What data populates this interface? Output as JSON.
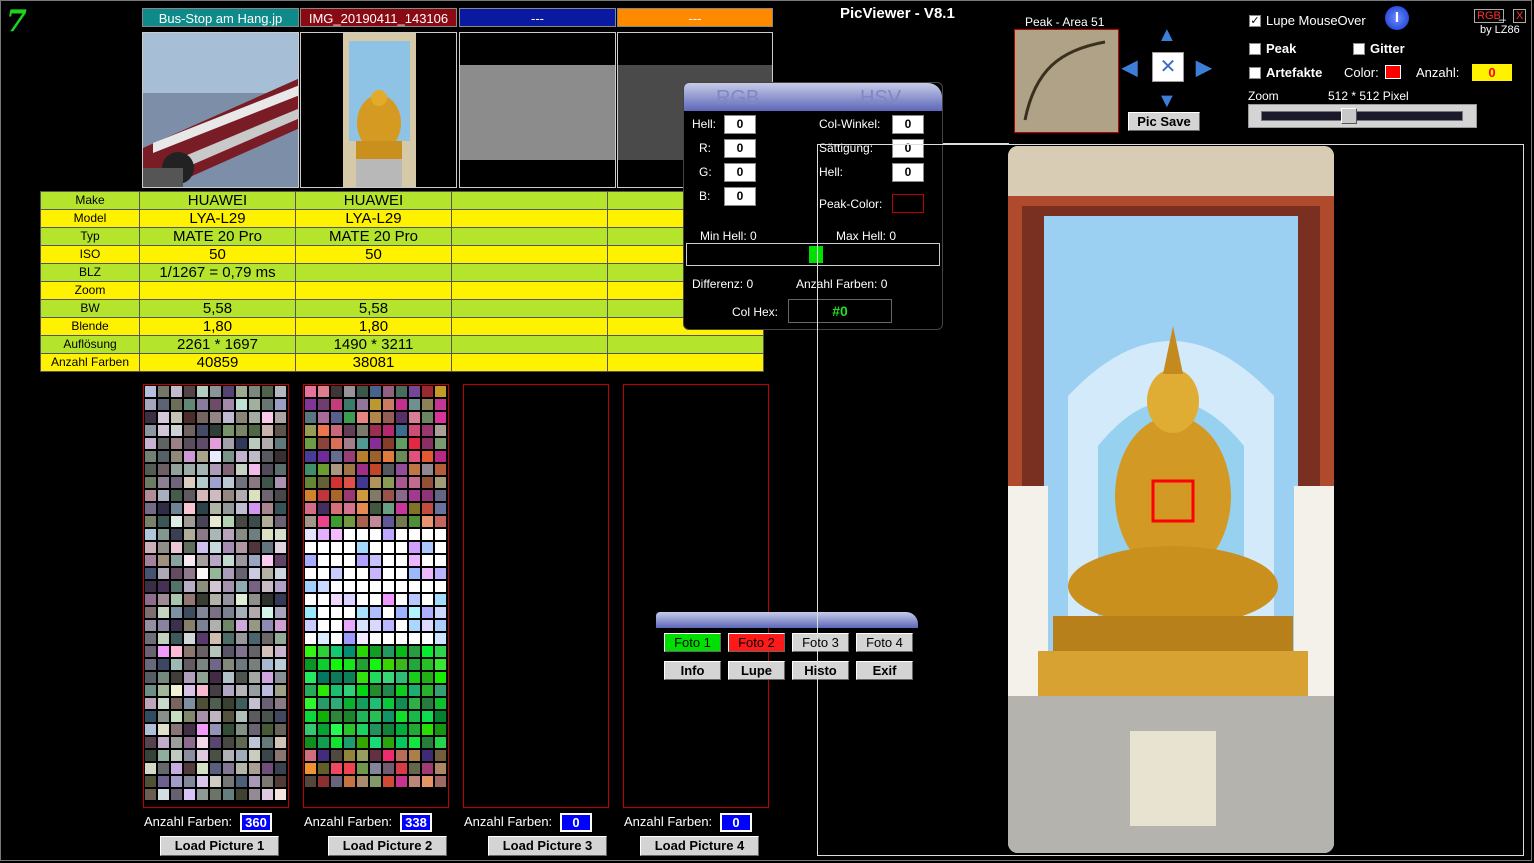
{
  "app": {
    "title": "PicViewer - V8.1",
    "logo": "7"
  },
  "tabs": [
    {
      "label": "Bus-Stop am Hang.jp",
      "color": "#0f8a8a"
    },
    {
      "label": "IMG_20190411_143106",
      "color": "#8a0a14"
    },
    {
      "label": "---",
      "color": "#0a1aa0"
    },
    {
      "label": "---",
      "color": "#ff8a00"
    }
  ],
  "exif": {
    "rows": [
      {
        "label": "Make",
        "v1": "HUAWEI",
        "v2": "HUAWEI",
        "v3": "",
        "v4": ""
      },
      {
        "label": "Model",
        "v1": "LYA-L29",
        "v2": "LYA-L29",
        "v3": "",
        "v4": ""
      },
      {
        "label": "Typ",
        "v1": "MATE 20 Pro",
        "v2": "MATE 20 Pro",
        "v3": "",
        "v4": ""
      },
      {
        "label": "ISO",
        "v1": "50",
        "v2": "50",
        "v3": "",
        "v4": ""
      },
      {
        "label": "BLZ",
        "v1": "1/1267 = 0,79 ms",
        "v2": "",
        "v3": "",
        "v4": ""
      },
      {
        "label": "Zoom",
        "v1": "",
        "v2": "",
        "v3": "",
        "v4": ""
      },
      {
        "label": "BW",
        "v1": "5,58",
        "v2": "5,58",
        "v3": "",
        "v4": ""
      },
      {
        "label": "Blende",
        "v1": "1,80",
        "v2": "1,80",
        "v3": "",
        "v4": ""
      },
      {
        "label": "Auflösung",
        "v1": "2261 * 1697",
        "v2": "1490 * 3211",
        "v3": "",
        "v4": ""
      },
      {
        "label": "Anzahl Farben",
        "v1": "40859",
        "v2": "38081",
        "v3": "",
        "v4": ""
      }
    ]
  },
  "palettes": [
    {
      "count_label": "Anzahl Farben:",
      "count": "360",
      "load": "Load Picture 1"
    },
    {
      "count_label": "Anzahl Farben:",
      "count": "338",
      "load": "Load Picture 2"
    },
    {
      "count_label": "Anzahl Farben:",
      "count": "0",
      "load": "Load Picture 3"
    },
    {
      "count_label": "Anzahl Farben:",
      "count": "0",
      "load": "Load Picture 4"
    }
  ],
  "color_panel": {
    "tab_rgb": "RGB",
    "tab_hsv": "HSV",
    "hell_label": "Hell:",
    "hell": "0",
    "r_label": "R:",
    "r": "0",
    "g_label": "G:",
    "g": "0",
    "b_label": "B:",
    "b": "0",
    "colwinkel_label": "Col-Winkel:",
    "colwinkel": "0",
    "saettigung_label": "Sättigung:",
    "saettigung": "0",
    "hsv_hell_label": "Hell:",
    "hsv_hell": "0",
    "peak_color_label": "Peak-Color:",
    "min_hell": "Min Hell:  0",
    "max_hell": "Max Hell:  0",
    "differenz": "Differenz:   0",
    "anzahl_farben": "Anzahl Farben:  0",
    "colhex_label": "Col Hex:",
    "colhex": "#0"
  },
  "foto_panel": {
    "foto1": "Foto 1",
    "foto2": "Foto 2",
    "foto3": "Foto 3",
    "foto4": "Foto 4",
    "info": "Info",
    "lupe": "Lupe",
    "histo": "Histo",
    "exif": "Exif"
  },
  "peak": {
    "title": "Peak - Area 51",
    "save": "Pic Save"
  },
  "options": {
    "lupe_mouseover": "Lupe MouseOver",
    "lupe_checked": true,
    "peak": "Peak",
    "gitter": "Gitter",
    "artefakte": "Artefakte",
    "color_label": "Color:",
    "color": "#ff0000",
    "anzahl_label": "Anzahl:",
    "anzahl": "0",
    "zoom_label": "Zoom",
    "zoom_value": "512 * 512 Pixel",
    "zoom_level": 0.43
  },
  "window": {
    "rgb": "RGB",
    "min": "_",
    "close": "X",
    "by": "by LZ86"
  }
}
